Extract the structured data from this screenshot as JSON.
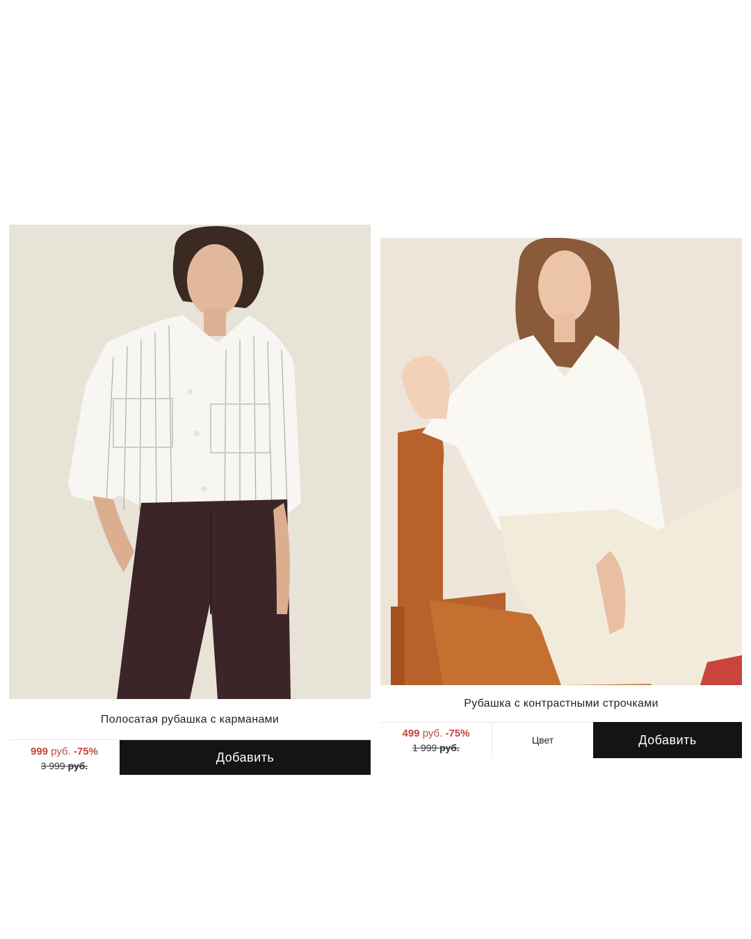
{
  "products": [
    {
      "title": "Полосатая рубашка с карманами",
      "price": {
        "new_value": "999",
        "unit": "руб.",
        "discount": "-75%",
        "old_value": "3 999",
        "old_unit": "руб."
      },
      "add_label": "Добавить",
      "image": "woman-in-striped-white-shirt-and-dark-trousers"
    },
    {
      "title": "Рубашка с контрастными строчками",
      "price": {
        "new_value": "499",
        "unit": "руб.",
        "discount": "-75%",
        "old_value": "1 999",
        "old_unit": "руб."
      },
      "color_label": "Цвет",
      "add_label": "Добавить",
      "image": "woman-in-white-shirt-seated-on-wooden-chair"
    }
  ],
  "colors": {
    "sale_red": "#c8443c",
    "button_black": "#141414",
    "photo_background": "#ece6dc"
  }
}
